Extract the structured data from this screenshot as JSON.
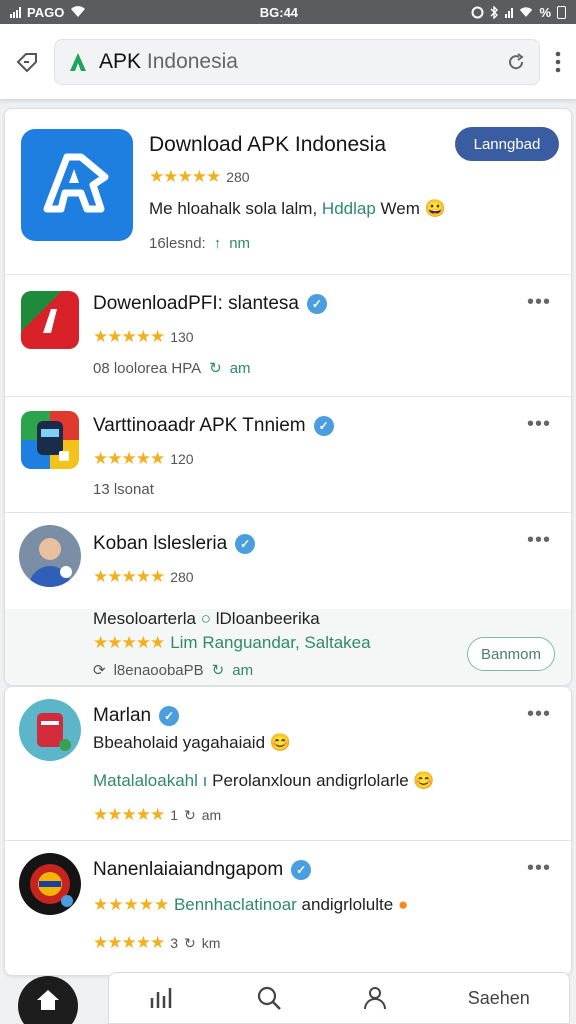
{
  "status_bar": {
    "carrier": "PAGO",
    "time": "BG:44",
    "battery": "%"
  },
  "browser": {
    "url_brand": "APK",
    "url_rest": "Indonesia"
  },
  "featured": {
    "title": "Download APK Indonesia",
    "rating": "280",
    "button": "Lanngbad",
    "description_a": "Me hloahalk sola lalm, ",
    "description_b": "Hddlap",
    "description_c": " Wem",
    "meta_a": "16lesnd:",
    "meta_b": "nm"
  },
  "items": [
    {
      "title": "DowenloadPFI: slantesa",
      "rating": "130",
      "meta_a": "08 loolorea HPA",
      "meta_b": "am"
    },
    {
      "title": "Varttinoaadr APK Tnniem",
      "rating": "120",
      "meta_a": "13 lsonat"
    },
    {
      "title": "Koban lslesleria",
      "rating": "280",
      "line_a": "Mesoloarterla",
      "line_b": "lDloanbeerika",
      "line_c": "Lim Ranguandar, Saltakea",
      "meta_a": "l8enaoobaPB",
      "meta_b": "am",
      "button": "Banmom"
    }
  ],
  "items2": [
    {
      "title": "Marlan",
      "subtitle": "Bbeaholaid yagahaiaid",
      "line_a": "Matalaloakahl",
      "line_b": "Perolanxloun andigrlolarle",
      "rating": "1",
      "meta_b": "am"
    },
    {
      "title": "Nanenlaiaiandngapom",
      "subtitle_a": "Bennhaclatinoar",
      "subtitle_b": " andigrlolulte",
      "rating": "3",
      "meta_b": "km"
    }
  ],
  "bottom_nav": {
    "label": "Saehen"
  },
  "colors": {
    "brand_blue": "#1e7fe0",
    "button_dark": "#3a5ca0",
    "star": "#f2b01e",
    "green": "#2f8a6a"
  }
}
